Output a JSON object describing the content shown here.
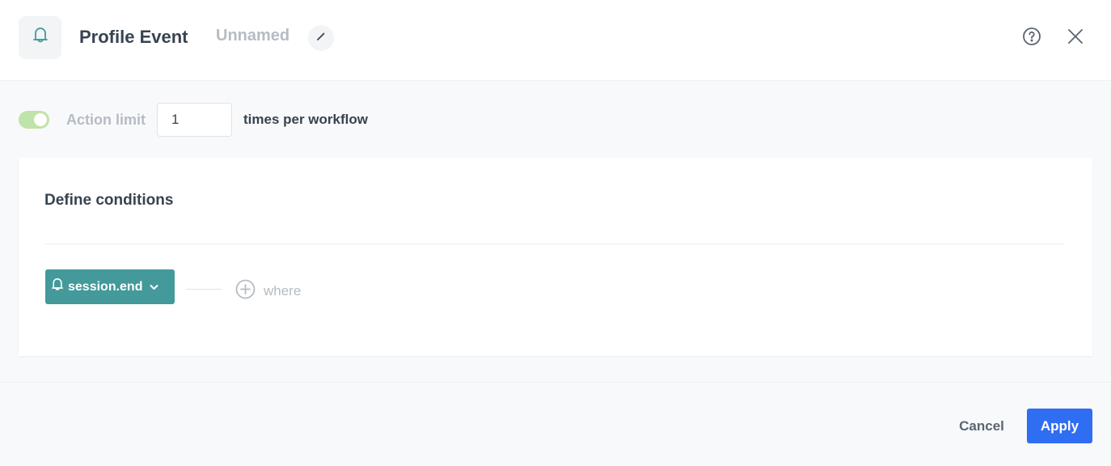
{
  "header": {
    "icon": "bell-icon",
    "title": "Profile Event",
    "subtitle": "Unnamed",
    "edit_icon": "pencil-icon",
    "help_icon": "question-circle-icon",
    "close_icon": "close-icon"
  },
  "action_limit": {
    "enabled": true,
    "label": "Action limit",
    "value": "1",
    "suffix": "times per workflow"
  },
  "conditions": {
    "title": "Define conditions",
    "event": {
      "icon": "bell-icon",
      "name": "session.end",
      "dropdown_icon": "chevron-down-icon"
    },
    "add_where": {
      "icon": "plus-circle-icon",
      "label": "where"
    }
  },
  "footer": {
    "cancel_label": "Cancel",
    "apply_label": "Apply"
  },
  "colors": {
    "accent": "#44999a",
    "primary": "#2f6df2",
    "toggle_on": "#bfe3a8"
  }
}
